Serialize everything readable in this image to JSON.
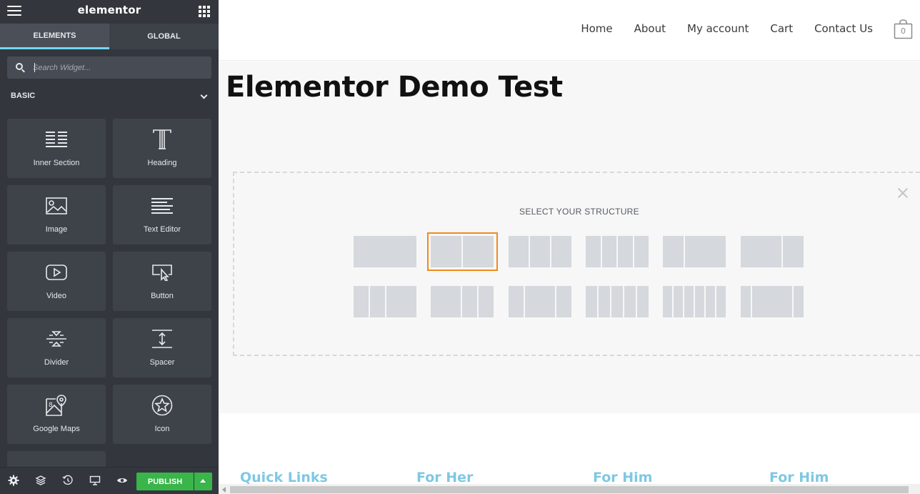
{
  "panel": {
    "brand": "elementor",
    "tabs": [
      {
        "label": "ELEMENTS",
        "active": true
      },
      {
        "label": "GLOBAL",
        "active": false
      }
    ],
    "search": {
      "placeholder": "Search Widget...",
      "value": ""
    },
    "category": "BASIC",
    "widgets": [
      {
        "label": "Inner Section",
        "icon": "inner-section-icon"
      },
      {
        "label": "Heading",
        "icon": "heading-icon"
      },
      {
        "label": "Image",
        "icon": "image-icon"
      },
      {
        "label": "Text Editor",
        "icon": "text-editor-icon"
      },
      {
        "label": "Video",
        "icon": "video-icon"
      },
      {
        "label": "Button",
        "icon": "button-icon"
      },
      {
        "label": "Divider",
        "icon": "divider-icon"
      },
      {
        "label": "Spacer",
        "icon": "spacer-icon"
      },
      {
        "label": "Google Maps",
        "icon": "google-maps-icon"
      },
      {
        "label": "Icon",
        "icon": "star-icon"
      }
    ],
    "footer": {
      "icons": [
        "settings-icon",
        "navigator-icon",
        "history-icon",
        "responsive-icon",
        "preview-icon"
      ],
      "publish_label": "PUBLISH"
    }
  },
  "site": {
    "nav": [
      "Home",
      "About",
      "My account",
      "Cart",
      "Contact Us"
    ],
    "cart_count": "0",
    "page_title": "Elementor Demo Test",
    "structure": {
      "title": "SELECT YOUR STRUCTURE",
      "presets": [
        {
          "cols": [
            100
          ],
          "selected": false
        },
        {
          "cols": [
            50,
            50
          ],
          "selected": true
        },
        {
          "cols": [
            33,
            33,
            33
          ],
          "selected": false
        },
        {
          "cols": [
            25,
            25,
            25,
            25
          ],
          "selected": false
        },
        {
          "cols": [
            33,
            66
          ],
          "selected": false
        },
        {
          "cols": [
            66,
            33
          ],
          "selected": false
        },
        {
          "cols": [
            25,
            25,
            50
          ],
          "selected": false
        },
        {
          "cols": [
            50,
            25,
            25
          ],
          "selected": false
        },
        {
          "cols": [
            25,
            50,
            25
          ],
          "selected": false
        },
        {
          "cols": [
            20,
            20,
            20,
            20,
            20
          ],
          "selected": false
        },
        {
          "cols": [
            16,
            16,
            16,
            16,
            16,
            16
          ],
          "selected": false
        },
        {
          "cols": [
            16,
            66,
            16
          ],
          "selected": false
        }
      ]
    },
    "footer_headings": [
      "Quick Links",
      "For Her",
      "For Him",
      "For Him"
    ]
  },
  "colors": {
    "panel_bg": "#33373d",
    "accent_tab": "#71d7f7",
    "publish": "#39b54a",
    "selected_outline": "#ef8b1f",
    "footer_heading": "#7ec8e3"
  }
}
